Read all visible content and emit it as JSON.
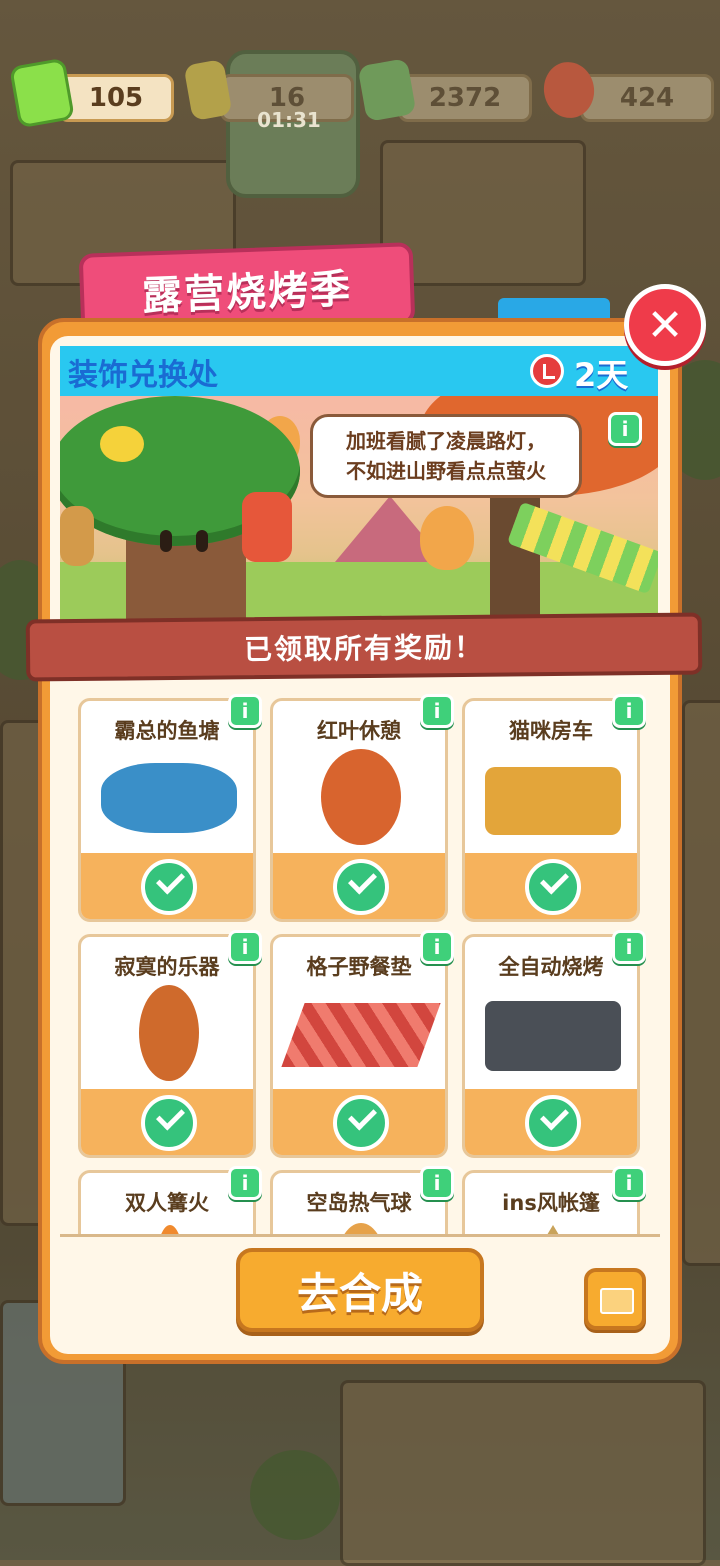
{
  "resources": {
    "vouchers": "105",
    "energy": "16",
    "energy_timer": "01:31",
    "cash": "2372",
    "gems": "424"
  },
  "event": {
    "banner_title": "露营烧烤季",
    "panel_title": "装饰兑换处",
    "time_left": "2天14时",
    "speech_line1": "加班看腻了凌晨路灯，",
    "speech_line2": "不如进山野看点点萤火",
    "claimed_text": "已领取所有奖励！",
    "info_label": "i"
  },
  "items": [
    {
      "name": "霸总的鱼塘",
      "claimed": true
    },
    {
      "name": "红叶休憩",
      "claimed": true
    },
    {
      "name": "猫咪房车",
      "claimed": true
    },
    {
      "name": "寂寞的乐器",
      "claimed": true
    },
    {
      "name": "格子野餐垫",
      "claimed": true
    },
    {
      "name": "全自动烧烤",
      "claimed": true
    },
    {
      "name": "双人篝火",
      "claimed": false
    },
    {
      "name": "空岛热气球",
      "claimed": false
    },
    {
      "name": "ins风帐篷",
      "claimed": false
    }
  ],
  "buttons": {
    "go_merge": "去合成",
    "close": "✕"
  },
  "colors": {
    "banner": "#ef4d7a",
    "panel": "#f29b36",
    "title_bar": "#29c8f0",
    "claimed_bar": "#b94f42",
    "check": "#35c37c"
  }
}
